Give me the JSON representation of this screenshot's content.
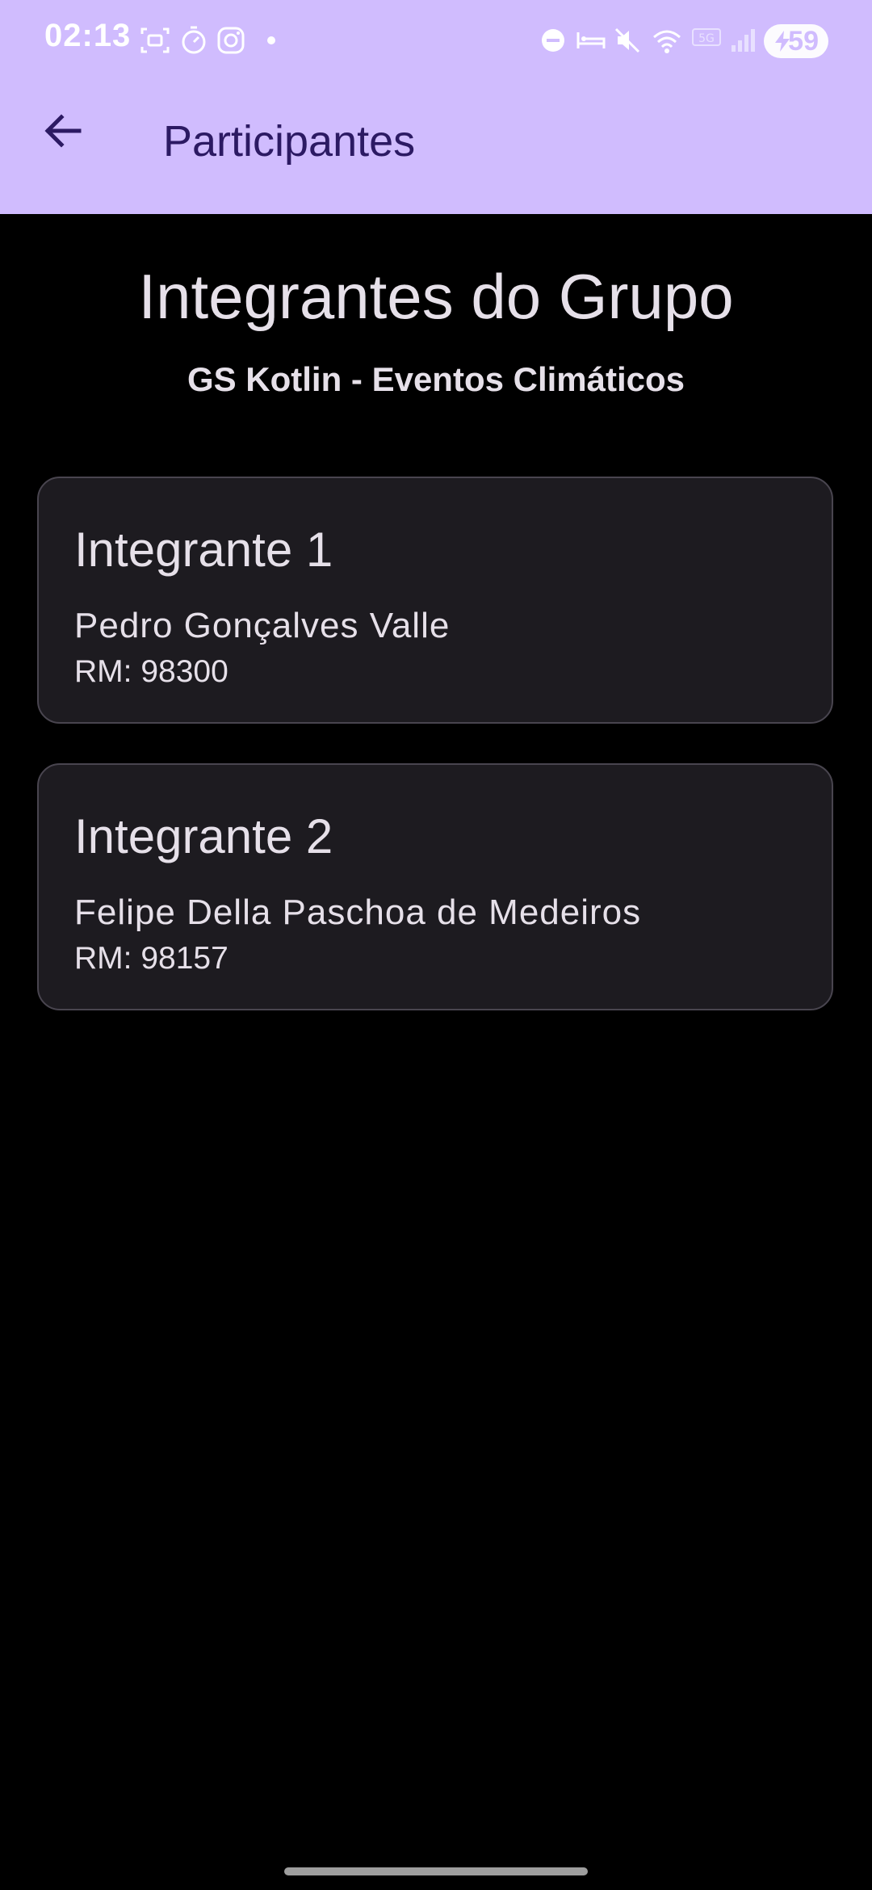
{
  "status_bar": {
    "time": "02:13",
    "battery_level": "59"
  },
  "app_bar": {
    "title": "Participantes",
    "back_icon": "arrow-back-icon"
  },
  "page": {
    "heading": "Integrantes do Grupo",
    "subheading": "GS Kotlin - Eventos Climáticos"
  },
  "members": [
    {
      "title": "Integrante 1",
      "name": "Pedro Gonçalves Valle",
      "rm": "RM: 98300"
    },
    {
      "title": "Integrante 2",
      "name": "Felipe Della Paschoa de Medeiros",
      "rm": "RM: 98157"
    }
  ],
  "colors": {
    "header_bg": "#d0bcfe",
    "title_text": "#2c1a63",
    "card_bg": "#1d1b20",
    "card_border": "#49454f",
    "body_text": "#e6e0e9",
    "background": "#000000"
  }
}
